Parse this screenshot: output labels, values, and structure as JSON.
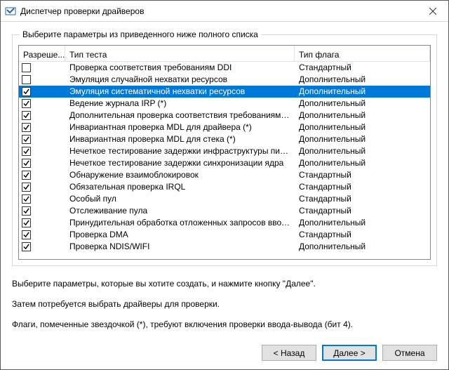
{
  "window": {
    "title": "Диспетчер проверки драйверов"
  },
  "groupbox": {
    "label": "Выберите параметры из приведенного ниже полного списка"
  },
  "columns": {
    "permission": "Разреше...",
    "test": "Тип теста",
    "flag": "Тип флага"
  },
  "flag_text": {
    "standard": "Стандартный",
    "additional": "Дополнительный"
  },
  "rows": [
    {
      "checked": false,
      "selected": false,
      "test": "Проверка соответствия требованиям DDI",
      "flag": "standard"
    },
    {
      "checked": false,
      "selected": false,
      "test": "Эмуляция случайной нехватки ресурсов",
      "flag": "additional"
    },
    {
      "checked": true,
      "selected": true,
      "test": "Эмуляция систематичной нехватки ресурсов",
      "flag": "additional"
    },
    {
      "checked": true,
      "selected": false,
      "test": "Ведение журнала IRP (*)",
      "flag": "additional"
    },
    {
      "checked": true,
      "selected": false,
      "test": "Дополнительная проверка соответствия требованиям DDI",
      "flag": "additional"
    },
    {
      "checked": true,
      "selected": false,
      "test": "Инвариантная проверка MDL для драйвера (*)",
      "flag": "additional"
    },
    {
      "checked": true,
      "selected": false,
      "test": "Инвариантная проверка MDL для стека (*)",
      "flag": "additional"
    },
    {
      "checked": true,
      "selected": false,
      "test": "Нечеткое тестирование задержки инфраструктуры питания",
      "flag": "additional"
    },
    {
      "checked": true,
      "selected": false,
      "test": "Нечеткое тестирование задержки синхронизации ядра",
      "flag": "additional"
    },
    {
      "checked": true,
      "selected": false,
      "test": "Обнаружение взаимоблокировок",
      "flag": "standard"
    },
    {
      "checked": true,
      "selected": false,
      "test": "Обязательная проверка IRQL",
      "flag": "standard"
    },
    {
      "checked": true,
      "selected": false,
      "test": "Особый пул",
      "flag": "standard"
    },
    {
      "checked": true,
      "selected": false,
      "test": "Отслеживание пула",
      "flag": "standard"
    },
    {
      "checked": true,
      "selected": false,
      "test": "Принудительная обработка отложенных запросов ввода-выво...",
      "flag": "additional"
    },
    {
      "checked": true,
      "selected": false,
      "test": "Проверка DMA",
      "flag": "standard"
    },
    {
      "checked": true,
      "selected": false,
      "test": "Проверка NDIS/WIFI",
      "flag": "additional"
    }
  ],
  "instructions": {
    "line1": "Выберите параметры, которые вы хотите создать, и нажмите кнопку \"Далее\".",
    "line2": "Затем потребуется выбрать драйверы для проверки.",
    "line3": "Флаги, помеченные звездочкой (*), требуют включения проверки ввода-вывода (бит 4)."
  },
  "buttons": {
    "back": "< Назад",
    "next": "Далее >",
    "cancel": "Отмена"
  }
}
